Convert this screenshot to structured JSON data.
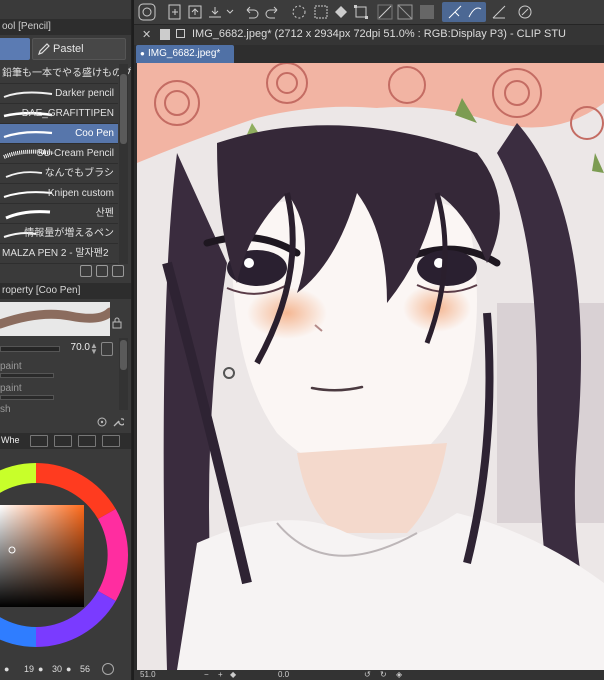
{
  "subtool_header": "Sub Tool [Pencil]",
  "subtool_header_visible": "ool [Pencil]",
  "tabs": {
    "pastel": "Pastel"
  },
  "brushes": [
    {
      "name": "鉛筆も一本でやる盛けものプ",
      "selected": false
    },
    {
      "name": "Darker pencil",
      "selected": false
    },
    {
      "name": "DAE_GRAFITTIPEN",
      "selected": false
    },
    {
      "name": "Coo Pen",
      "selected": true
    },
    {
      "name": "SU-Cream Pencil",
      "selected": false
    },
    {
      "name": "なんでもブラシ",
      "selected": false
    },
    {
      "name": "Knipen custom",
      "selected": false
    },
    {
      "name": "산펜",
      "selected": false
    },
    {
      "name": "情報量が増えるペン",
      "selected": false
    },
    {
      "name": "MALZA PEN 2 - 말자펜2",
      "selected": false
    }
  ],
  "property": {
    "header": "roperty [Coo Pen]",
    "brush_size_value": "70.0",
    "rows": [
      "paint",
      "paint",
      "sh"
    ]
  },
  "color_wheel": {
    "tab_label": "Whe",
    "hue": "#ff6a1a"
  },
  "swatch_sizes": [
    "19",
    "30",
    "56"
  ],
  "toolbar": {
    "icons": [
      "app-menu-icon",
      "new-file-icon",
      "open-file-icon",
      "save-icon",
      "undo-icon",
      "redo-icon",
      "loading-icon",
      "fill-icon",
      "transform-icon",
      "clear-icon",
      "selection-icon",
      "ruler-icon",
      "stabilizer-icon",
      "pen-pressure-icon",
      "settings-icon"
    ]
  },
  "document": {
    "title": "IMG_6682.jpeg* (2712 x 2934px 72dpi 51.0% : RGB:Display P3)  - CLIP STU",
    "tab": "IMG_6682.jpeg*"
  },
  "status": {
    "zoom": "51.0",
    "angle": "0.0"
  },
  "colors": {
    "accent": "#5776ab",
    "panel": "#3a3a3a",
    "header": "#2d2d2d"
  }
}
